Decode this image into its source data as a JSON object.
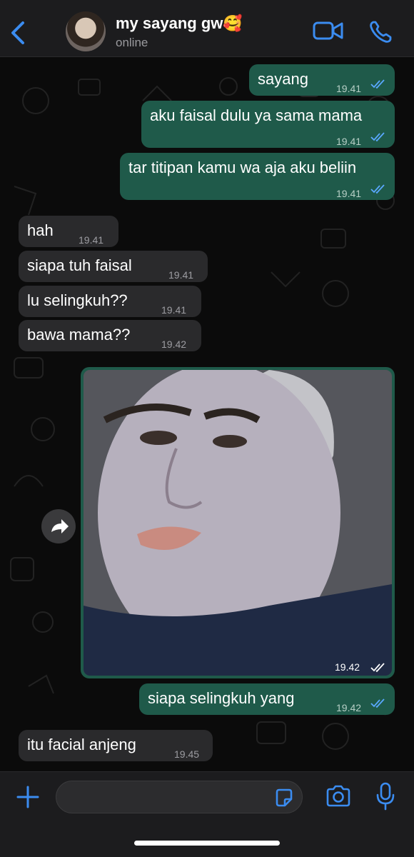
{
  "header": {
    "contact_name": "my sayang gw🥰",
    "status": "online",
    "icons": [
      "back-chevron-icon",
      "video-call-icon",
      "phone-icon"
    ]
  },
  "messages": [
    {
      "dir": "out",
      "text": "sayang",
      "time": "19.41",
      "read": true
    },
    {
      "dir": "out",
      "text": "aku faisal dulu ya sama mama",
      "time": "19.41",
      "read": true
    },
    {
      "dir": "out",
      "text": "tar titipan kamu wa aja aku beliin",
      "time": "19.41",
      "read": true
    },
    {
      "dir": "in",
      "text": "hah",
      "time": "19.41"
    },
    {
      "dir": "in",
      "text": "siapa tuh faisal",
      "time": "19.41"
    },
    {
      "dir": "in",
      "text": "lu selingkuh??",
      "time": "19.41"
    },
    {
      "dir": "in",
      "text": "bawa mama??",
      "time": "19.42"
    },
    {
      "dir": "out",
      "type": "image",
      "time": "19.42",
      "read": true,
      "image_desc_icon": "photo"
    },
    {
      "dir": "out",
      "text": "siapa selingkuh yang",
      "time": "19.42",
      "read": true
    },
    {
      "dir": "in",
      "text": "itu facial anjeng",
      "time": "19.45"
    }
  ],
  "bottom_bar": {
    "input_placeholder": "",
    "icons": [
      "plus-icon",
      "sticker-icon",
      "camera-icon",
      "microphone-icon"
    ]
  },
  "colors": {
    "accent": "#3b8cf0",
    "outgoing_bubble": "#1f5a4a",
    "incoming_bubble": "#2a2a2c",
    "background": "#0b0b0b"
  }
}
